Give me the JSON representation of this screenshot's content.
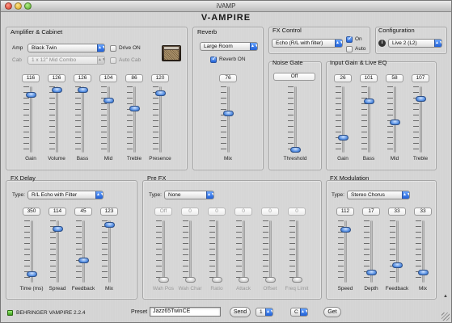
{
  "window": {
    "title": "iVAMP",
    "app_title": "V-AMPIRE"
  },
  "amp_cab": {
    "title": "Amplifier & Cabinet",
    "amp_label": "Amp",
    "amp_value": "Black Twin",
    "cab_label": "Cab",
    "cab_value": "1 x 12\" Mid Combo",
    "drive_on_label": "Drive ON",
    "auto_cab_label": "Auto Cab",
    "sliders": [
      {
        "label": "Gain",
        "value": "116",
        "level": 0.91
      },
      {
        "label": "Volume",
        "value": "126",
        "level": 0.99
      },
      {
        "label": "Bass",
        "value": "126",
        "level": 0.99
      },
      {
        "label": "Mid",
        "value": "104",
        "level": 0.82
      },
      {
        "label": "Treble",
        "value": "86",
        "level": 0.68
      },
      {
        "label": "Presence",
        "value": "120",
        "level": 0.94
      }
    ]
  },
  "reverb": {
    "title": "Reverb",
    "type_value": "Large Room",
    "on_label": "Reverb ON",
    "slider": {
      "label": "Mix",
      "value": "76",
      "level": 0.6
    }
  },
  "fx_control": {
    "title": "FX Control",
    "select_value": "Echo (R/L with filter)",
    "on_label": "On",
    "auto_label": "Auto"
  },
  "noise_gate": {
    "title": "Noise Gate",
    "value": "Off",
    "slider": {
      "label": "Threshold",
      "level": 0.0
    }
  },
  "input_gain": {
    "title": "Input Gain & Live EQ",
    "sliders": [
      {
        "label": "Gain",
        "value": "26",
        "level": 0.2
      },
      {
        "label": "Bass",
        "value": "101",
        "level": 0.8
      },
      {
        "label": "Mid",
        "value": "58",
        "level": 0.46
      },
      {
        "label": "Treble",
        "value": "107",
        "level": 0.84
      }
    ]
  },
  "configuration": {
    "title": "Configuration",
    "info_icon": "i",
    "select_value": "Live 2 (L2)"
  },
  "fx_delay": {
    "title": "FX Delay",
    "type_label": "Type:",
    "type_value": "R/L Echo with Filter",
    "sliders": [
      {
        "label": "Time (ms)",
        "value": "350",
        "level": 0.1
      },
      {
        "label": "Spread",
        "value": "114",
        "level": 0.9
      },
      {
        "label": "Feedback",
        "value": "45",
        "level": 0.35
      },
      {
        "label": "Mix",
        "value": "123",
        "level": 0.97
      }
    ]
  },
  "pre_fx": {
    "title": "Pre FX",
    "type_label": "Type:",
    "type_value": "None",
    "sliders": [
      {
        "label": "Wah Pos",
        "value": "Off",
        "level": 0.0
      },
      {
        "label": "Wah Char",
        "value": "0",
        "level": 0.0
      },
      {
        "label": "Ratio",
        "value": "0",
        "level": 0.0
      },
      {
        "label": "Attack",
        "value": "0",
        "level": 0.0
      },
      {
        "label": "Offset",
        "value": "0",
        "level": 0.0
      },
      {
        "label": "Freq Limit",
        "value": "0",
        "level": 0.0
      }
    ]
  },
  "fx_modulation": {
    "title": "FX Modulation",
    "type_label": "Type:",
    "type_value": "Stereo Chorus",
    "sliders": [
      {
        "label": "Speed",
        "value": "112",
        "level": 0.88
      },
      {
        "label": "Depth",
        "value": "17",
        "level": 0.13
      },
      {
        "label": "Feedback",
        "value": "33",
        "level": 0.26
      },
      {
        "label": "Mix",
        "value": "33",
        "level": 0.13
      }
    ]
  },
  "bottom": {
    "device_label": "BEHRINGER VAMPIRE 2.2.4",
    "preset_label": "Preset",
    "preset_value": "Jazz65TwinCE",
    "send_label": "Send",
    "bank_value": "1",
    "slot_value": "C",
    "get_label": "Get"
  },
  "colors": {
    "accent": "#2f6fd8",
    "led": "#5bc43a"
  }
}
